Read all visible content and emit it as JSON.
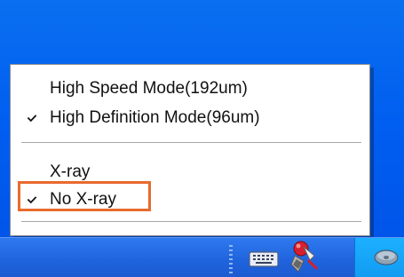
{
  "context_menu": {
    "items": [
      {
        "label": "High Speed Mode(192um)",
        "checked": false
      },
      {
        "label": "High Definition Mode(96um)",
        "checked": true
      },
      {
        "label": "X-ray",
        "checked": false
      },
      {
        "label": "No X-ray",
        "checked": true
      }
    ],
    "highlighted_item": "No X-ray"
  },
  "system_tray": {
    "icons": [
      "keyboard-icon",
      "xray-app-icon",
      "disk-icon"
    ]
  },
  "colors": {
    "desktop_blue": "#005ef0",
    "highlight_orange": "#e86a2e",
    "taskbar_blue": "#1f63dc",
    "clock_area_blue": "#119bf2"
  }
}
